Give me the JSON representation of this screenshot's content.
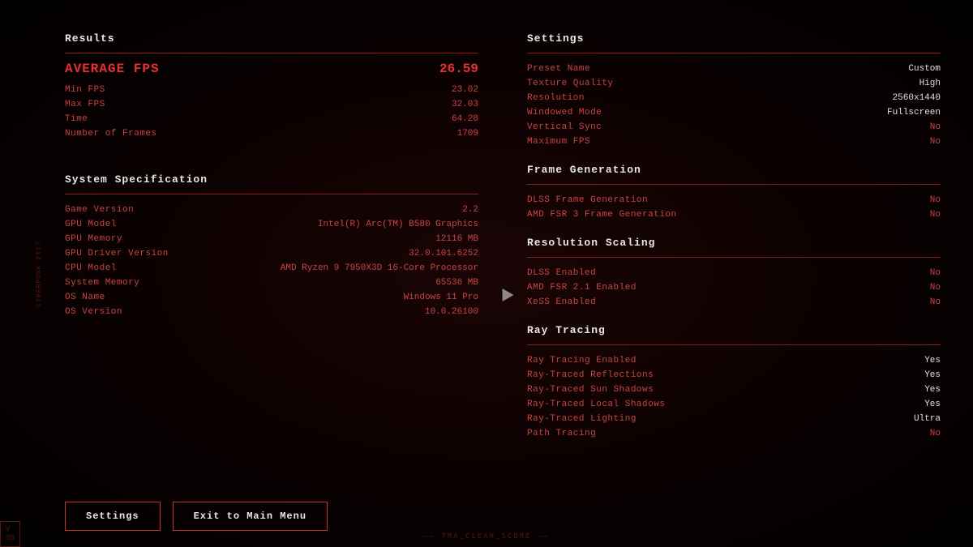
{
  "left": {
    "results_header": "Results",
    "average_fps_label": "Average FPS",
    "average_fps_value": "26.59",
    "stats": [
      {
        "label": "Min FPS",
        "value": "23.02"
      },
      {
        "label": "Max FPS",
        "value": "32.03"
      },
      {
        "label": "Time",
        "value": "64.28"
      },
      {
        "label": "Number of Frames",
        "value": "1709"
      }
    ],
    "spec_header": "System Specification",
    "specs": [
      {
        "label": "Game Version",
        "value": "2.2"
      },
      {
        "label": "GPU Model",
        "value": "Intel(R) Arc(TM) B580 Graphics"
      },
      {
        "label": "GPU Memory",
        "value": "12116 MB"
      },
      {
        "label": "GPU Driver Version",
        "value": "32.0.101.6252"
      },
      {
        "label": "CPU Model",
        "value": "AMD Ryzen 9 7950X3D 16-Core Processor"
      },
      {
        "label": "System Memory",
        "value": "65536 MB"
      },
      {
        "label": "OS Name",
        "value": "Windows 11 Pro"
      },
      {
        "label": "OS Version",
        "value": "10.0.26100"
      }
    ],
    "btn_settings": "Settings",
    "btn_exit": "Exit to Main Menu"
  },
  "right": {
    "settings_header": "Settings",
    "settings": [
      {
        "label": "Preset Name",
        "value": "Custom",
        "highlight": true
      },
      {
        "label": "Texture Quality",
        "value": "High",
        "highlight": true
      },
      {
        "label": "Resolution",
        "value": "2560x1440",
        "highlight": true
      },
      {
        "label": "Windowed Mode",
        "value": "Fullscreen",
        "highlight": true
      },
      {
        "label": "Vertical Sync",
        "value": "No",
        "highlight": false
      },
      {
        "label": "Maximum FPS",
        "value": "No",
        "highlight": false
      }
    ],
    "frame_gen_header": "Frame Generation",
    "frame_gen": [
      {
        "label": "DLSS Frame Generation",
        "value": "No"
      },
      {
        "label": "AMD FSR 3 Frame Generation",
        "value": "No"
      }
    ],
    "res_scaling_header": "Resolution Scaling",
    "res_scaling": [
      {
        "label": "DLSS Enabled",
        "value": "No"
      },
      {
        "label": "AMD FSR 2.1 Enabled",
        "value": "No"
      },
      {
        "label": "XeSS Enabled",
        "value": "No"
      }
    ],
    "ray_tracing_header": "Ray Tracing",
    "ray_tracing": [
      {
        "label": "Ray Tracing Enabled",
        "value": "Yes",
        "highlight": true
      },
      {
        "label": "Ray-Traced Reflections",
        "value": "Yes",
        "highlight": true
      },
      {
        "label": "Ray-Traced Sun Shadows",
        "value": "Yes",
        "highlight": true
      },
      {
        "label": "Ray-Traced Local Shadows",
        "value": "Yes",
        "highlight": true
      },
      {
        "label": "Ray-Traced Lighting",
        "value": "Ultra",
        "highlight": true
      },
      {
        "label": "Path Tracing",
        "value": "No",
        "highlight": false
      }
    ]
  },
  "bottom": {
    "center_text": "——  TRA_CLEAR_SCORE  ——",
    "version_line1": "V",
    "version_line2": "05"
  }
}
